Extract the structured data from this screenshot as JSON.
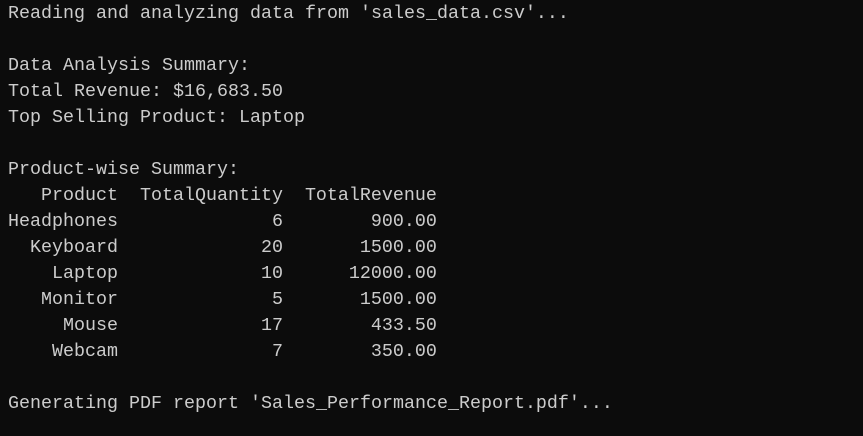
{
  "colors": {
    "background": "#0c0c0c",
    "text": "#cccccc"
  },
  "lines": {
    "reading": "Reading and analyzing data from 'sales_data.csv'...",
    "summary_title": "Data Analysis Summary:",
    "total_revenue": "Total Revenue: $16,683.50",
    "top_product": "Top Selling Product: Laptop",
    "product_summary_title": "Product-wise Summary:",
    "generating": "Generating PDF report 'Sales_Performance_Report.pdf'..."
  },
  "table": {
    "headers": [
      "Product",
      "TotalQuantity",
      "TotalRevenue"
    ],
    "rows": [
      [
        "Headphones",
        "6",
        "900.00"
      ],
      [
        "Keyboard",
        "20",
        "1500.00"
      ],
      [
        "Laptop",
        "10",
        "12000.00"
      ],
      [
        "Monitor",
        "5",
        "1500.00"
      ],
      [
        "Mouse",
        "17",
        "433.50"
      ],
      [
        "Webcam",
        "7",
        "350.00"
      ]
    ]
  }
}
